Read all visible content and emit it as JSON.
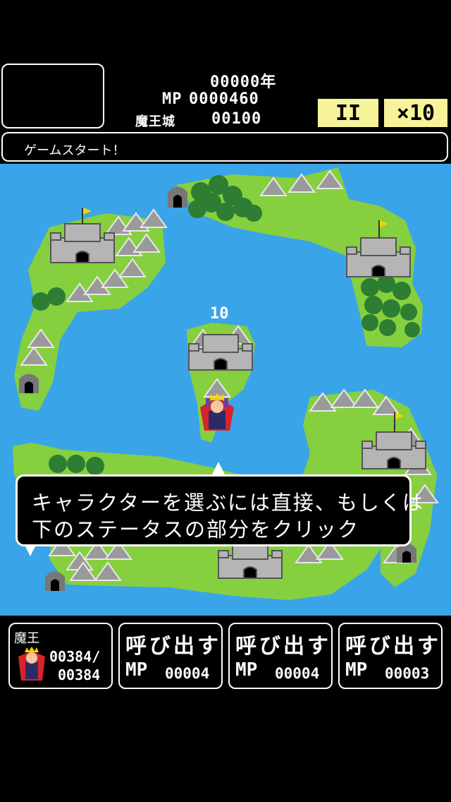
{
  "hud": {
    "year": "00000年",
    "mp_label": "MP",
    "mp_value": "0000460",
    "castle_label": "魔王城",
    "castle_value": "00100",
    "pause_label": "II",
    "speed_label": "×10"
  },
  "message": "ゲームスタート！",
  "map": {
    "castle_hp": "10"
  },
  "tutorial": {
    "line1": "キャラクターを選ぶには直接、もしくは",
    "line2": "下のステータスの部分をクリック"
  },
  "slots": [
    {
      "name": "魔王",
      "hp_current": "00384/",
      "hp_max": "00384"
    },
    {
      "label": "呼び出す",
      "mp_label": "MP",
      "mp_value": "00004"
    },
    {
      "label": "呼び出す",
      "mp_label": "MP",
      "mp_value": "00004"
    },
    {
      "label": "呼び出す",
      "mp_label": "MP",
      "mp_value": "00003"
    }
  ],
  "colors": {
    "sea": "#3aa4e8",
    "land": "#86cf3f",
    "button_yellow": "#f7f39a",
    "demon_cape": "#d8232b"
  }
}
